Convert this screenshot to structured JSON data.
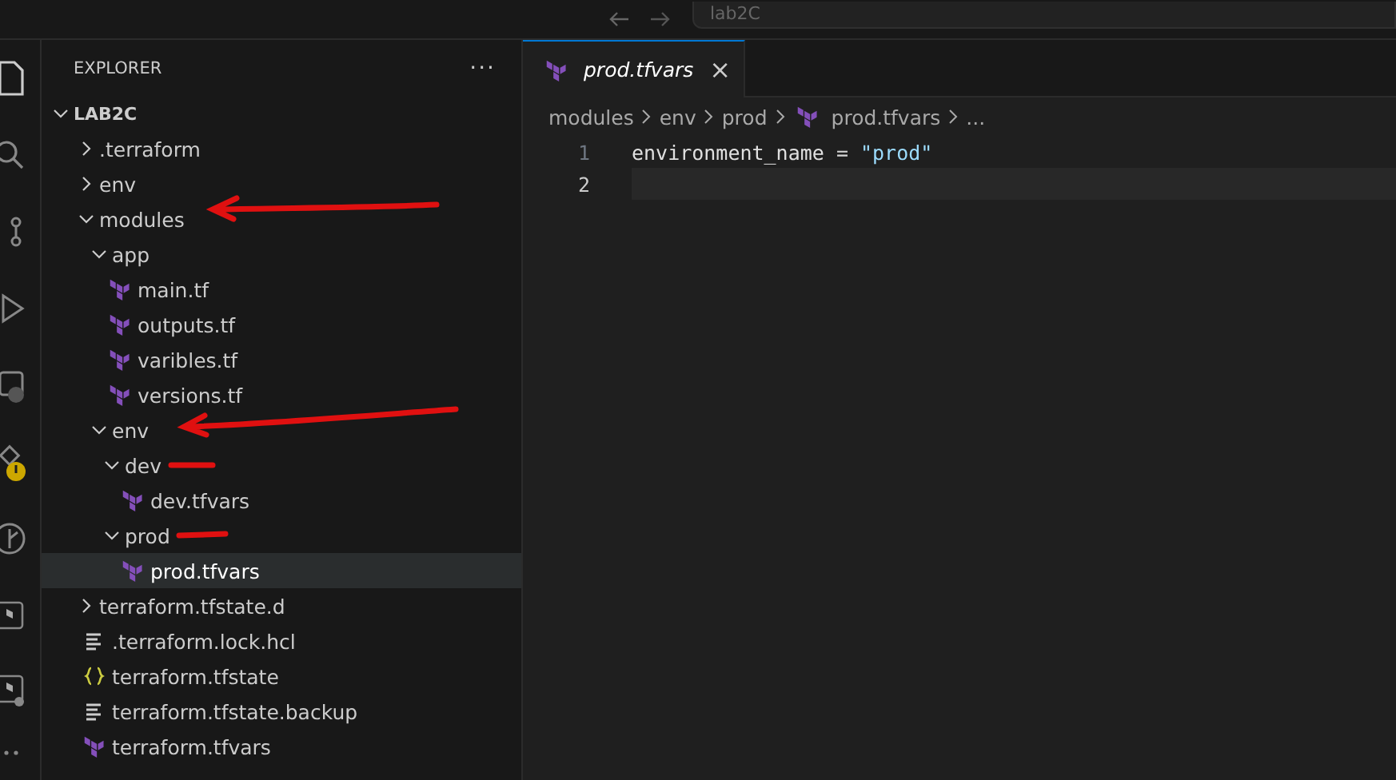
{
  "title_bar": {
    "search_text": "lab2C"
  },
  "sidebar": {
    "title": "EXPLORER",
    "more": "···",
    "root": {
      "label": "LAB2C",
      "expanded": true
    },
    "tree": [
      {
        "label": ".terraform",
        "kind": "folder",
        "expanded": false,
        "selected": false
      },
      {
        "label": "env",
        "kind": "folder",
        "expanded": false,
        "selected": false
      },
      {
        "label": "modules",
        "kind": "folder",
        "expanded": true,
        "selected": false,
        "children": [
          {
            "label": "app",
            "kind": "folder",
            "expanded": true,
            "selected": false,
            "children": [
              {
                "label": "main.tf",
                "kind": "terraform",
                "selected": false
              },
              {
                "label": "outputs.tf",
                "kind": "terraform",
                "selected": false
              },
              {
                "label": "varibles.tf",
                "kind": "terraform",
                "selected": false
              },
              {
                "label": "versions.tf",
                "kind": "terraform",
                "selected": false
              }
            ]
          },
          {
            "label": "env",
            "kind": "folder",
            "expanded": true,
            "selected": false,
            "children": [
              {
                "label": "dev",
                "kind": "folder",
                "expanded": true,
                "selected": false,
                "children": [
                  {
                    "label": "dev.tfvars",
                    "kind": "terraform",
                    "selected": false
                  }
                ]
              },
              {
                "label": "prod",
                "kind": "folder",
                "expanded": true,
                "selected": false,
                "children": [
                  {
                    "label": "prod.tfvars",
                    "kind": "terraform",
                    "selected": true
                  }
                ]
              }
            ]
          }
        ]
      },
      {
        "label": "terraform.tfstate.d",
        "kind": "folder",
        "expanded": false,
        "selected": false
      },
      {
        "label": ".terraform.lock.hcl",
        "kind": "lines",
        "selected": false
      },
      {
        "label": "terraform.tfstate",
        "kind": "braces",
        "selected": false
      },
      {
        "label": "terraform.tfstate.backup",
        "kind": "lines",
        "selected": false
      },
      {
        "label": "terraform.tfvars",
        "kind": "terraform",
        "selected": false
      }
    ]
  },
  "editor": {
    "tabs": [
      {
        "label": "prod.tfvars",
        "close": "×",
        "selected": true
      }
    ],
    "breadcrumb": [
      {
        "label": "modules",
        "kind": "text"
      },
      {
        "label": "env",
        "kind": "text"
      },
      {
        "label": "prod",
        "kind": "text"
      },
      {
        "label": "prod.tfvars",
        "kind": "terraform"
      },
      {
        "label": "...",
        "kind": "text"
      }
    ],
    "lines": [
      {
        "number": "1",
        "current": false,
        "tokens": [
          {
            "text": "environment_name",
            "kind": "name"
          },
          {
            "text": " = ",
            "kind": "op"
          },
          {
            "text": "\"prod\"",
            "kind": "string"
          }
        ]
      },
      {
        "number": "2",
        "current": true
      }
    ]
  }
}
